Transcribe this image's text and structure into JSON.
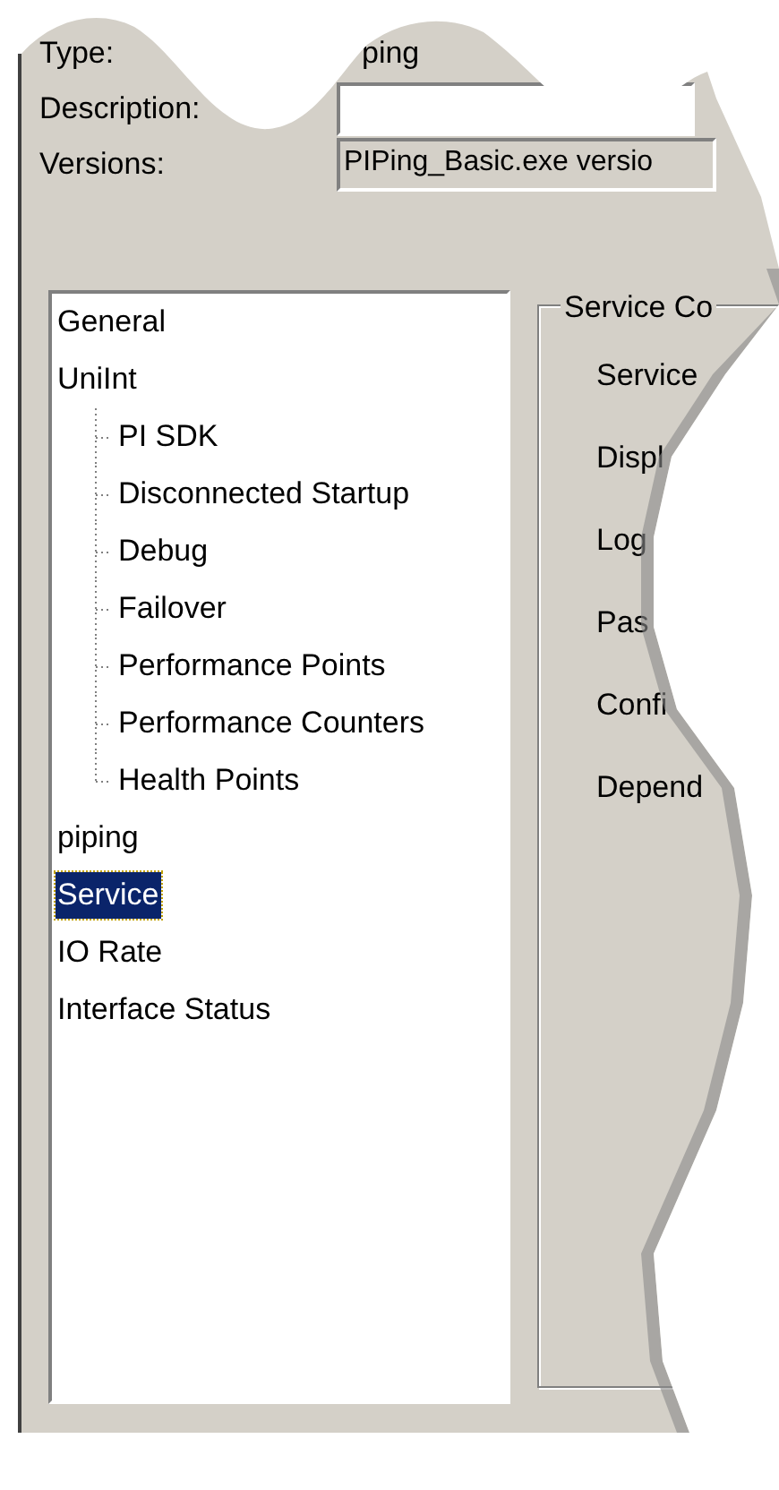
{
  "fields": [
    {
      "label": "Type:",
      "value": "ping",
      "kind": "text"
    },
    {
      "label": "Description:",
      "kind": "input"
    },
    {
      "label": "Versions:",
      "value": "PIPing_Basic.exe versio",
      "kind": "readonly"
    }
  ],
  "tree": [
    {
      "label": "General",
      "selected": false
    },
    {
      "label": "UniInt",
      "selected": false,
      "children": [
        {
          "label": "PI SDK",
          "selected": false
        },
        {
          "label": "Disconnected Startup",
          "selected": false
        },
        {
          "label": "Debug",
          "selected": false
        },
        {
          "label": "Failover",
          "selected": false
        },
        {
          "label": "Performance Points",
          "selected": false
        },
        {
          "label": "Performance Counters",
          "selected": false
        },
        {
          "label": "Health Points",
          "selected": false
        }
      ]
    },
    {
      "label": "piping",
      "selected": false
    },
    {
      "label": "Service",
      "selected": true
    },
    {
      "label": "IO Rate",
      "selected": false
    },
    {
      "label": "Interface Status",
      "selected": false
    }
  ],
  "group": {
    "title": "Service Co",
    "labels": [
      "Service",
      "Displ",
      "Log",
      "Pas",
      "Confi",
      "Depend"
    ]
  }
}
